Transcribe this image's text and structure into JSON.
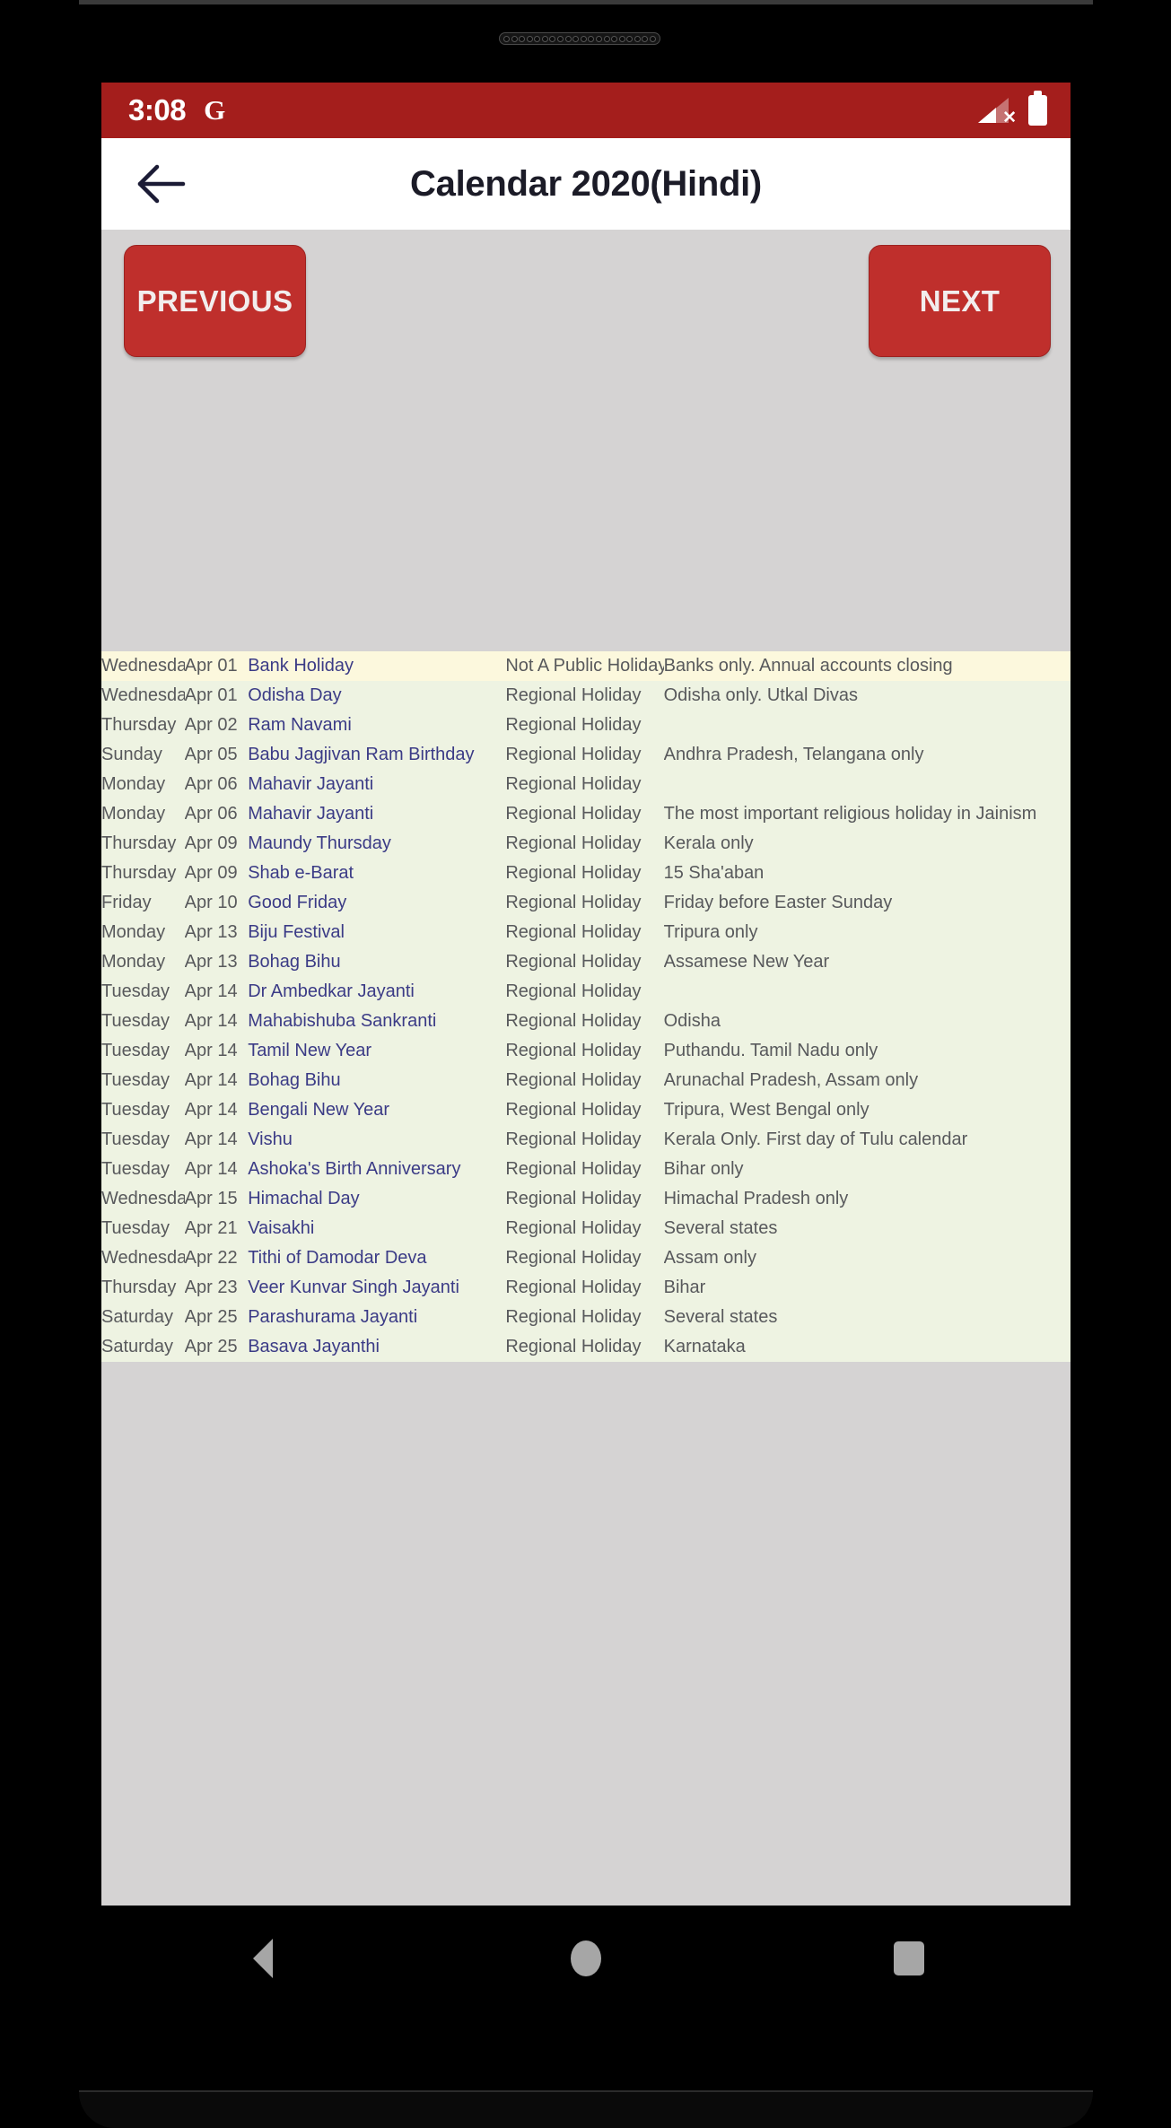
{
  "statusbar": {
    "time": "3:08",
    "google_icon": "G",
    "signal_icon": "signal-no-service-icon",
    "battery_icon": "battery-full-icon"
  },
  "appbar": {
    "back_icon": "back-arrow-icon",
    "title": "Calendar 2020(Hindi)"
  },
  "controls": {
    "previous_label": "PREVIOUS",
    "next_label": "NEXT"
  },
  "colors": {
    "status_bar": "#a41e1c",
    "button": "#bf2f2c",
    "page_background": "#d5d3d3",
    "bank_holiday_row": "#fcf8dd",
    "regional_holiday_row": "#eef3e2",
    "holiday_name_text": "#3b3b86",
    "body_text": "#58595c"
  },
  "holidays": [
    {
      "day": "Wednesday",
      "date": "Apr 01",
      "name": "Bank Holiday",
      "type": "Not A Public Holiday",
      "note": "Banks only. Annual accounts closing",
      "style": "row-bank"
    },
    {
      "day": "Wednesday",
      "date": "Apr 01",
      "name": "Odisha Day",
      "type": "Regional Holiday",
      "note": "Odisha only. Utkal Divas",
      "style": "row-regional"
    },
    {
      "day": "Thursday",
      "date": "Apr 02",
      "name": "Ram Navami",
      "type": "Regional Holiday",
      "note": "",
      "style": "row-regional"
    },
    {
      "day": "Sunday",
      "date": "Apr 05",
      "name": "Babu Jagjivan Ram Birthday",
      "type": "Regional Holiday",
      "note": "Andhra Pradesh, Telangana only",
      "style": "row-regional"
    },
    {
      "day": "Monday",
      "date": "Apr 06",
      "name": "Mahavir Jayanti",
      "type": "Regional Holiday",
      "note": "",
      "style": "row-regional"
    },
    {
      "day": "Monday",
      "date": "Apr 06",
      "name": "Mahavir Jayanti",
      "type": "Regional Holiday",
      "note": "The most important religious holiday in Jainism",
      "style": "row-regional"
    },
    {
      "day": "Thursday",
      "date": "Apr 09",
      "name": "Maundy Thursday",
      "type": "Regional Holiday",
      "note": "Kerala only",
      "style": "row-regional"
    },
    {
      "day": "Thursday",
      "date": "Apr 09",
      "name": "Shab e-Barat",
      "type": "Regional Holiday",
      "note": "15 Sha'aban",
      "style": "row-regional"
    },
    {
      "day": "Friday",
      "date": "Apr 10",
      "name": "Good Friday",
      "type": "Regional Holiday",
      "note": "Friday before Easter Sunday",
      "style": "row-regional"
    },
    {
      "day": "Monday",
      "date": "Apr 13",
      "name": "Biju Festival",
      "type": "Regional Holiday",
      "note": "Tripura only",
      "style": "row-regional"
    },
    {
      "day": "Monday",
      "date": "Apr 13",
      "name": "Bohag Bihu",
      "type": "Regional Holiday",
      "note": "Assamese New Year",
      "style": "row-regional"
    },
    {
      "day": "Tuesday",
      "date": "Apr 14",
      "name": "Dr Ambedkar Jayanti",
      "type": "Regional Holiday",
      "note": "",
      "style": "row-regional"
    },
    {
      "day": "Tuesday",
      "date": "Apr 14",
      "name": "Mahabishuba Sankranti",
      "type": "Regional Holiday",
      "note": "Odisha",
      "style": "row-regional"
    },
    {
      "day": "Tuesday",
      "date": "Apr 14",
      "name": "Tamil New Year",
      "type": "Regional Holiday",
      "note": "Puthandu. Tamil Nadu only",
      "style": "row-regional"
    },
    {
      "day": "Tuesday",
      "date": "Apr 14",
      "name": "Bohag Bihu",
      "type": "Regional Holiday",
      "note": "Arunachal Pradesh, Assam only",
      "style": "row-regional"
    },
    {
      "day": "Tuesday",
      "date": "Apr 14",
      "name": "Bengali New Year",
      "type": "Regional Holiday",
      "note": "Tripura, West Bengal only",
      "style": "row-regional"
    },
    {
      "day": "Tuesday",
      "date": "Apr 14",
      "name": "Vishu",
      "type": "Regional Holiday",
      "note": "Kerala Only. First day of Tulu calendar",
      "style": "row-regional"
    },
    {
      "day": "Tuesday",
      "date": "Apr 14",
      "name": "Ashoka's Birth Anniversary",
      "type": "Regional Holiday",
      "note": "Bihar only",
      "style": "row-regional"
    },
    {
      "day": "Wednesday",
      "date": "Apr 15",
      "name": "Himachal Day",
      "type": "Regional Holiday",
      "note": "Himachal Pradesh only",
      "style": "row-regional"
    },
    {
      "day": "Tuesday",
      "date": "Apr 21",
      "name": "Vaisakhi",
      "type": "Regional Holiday",
      "note": "Several states",
      "style": "row-regional"
    },
    {
      "day": "Wednesday",
      "date": "Apr 22",
      "name": "Tithi of Damodar Deva",
      "type": "Regional Holiday",
      "note": "Assam only",
      "style": "row-regional"
    },
    {
      "day": "Thursday",
      "date": "Apr 23",
      "name": "Veer Kunvar Singh Jayanti",
      "type": "Regional Holiday",
      "note": "Bihar",
      "style": "row-regional"
    },
    {
      "day": "Saturday",
      "date": "Apr 25",
      "name": "Parashurama Jayanti",
      "type": "Regional Holiday",
      "note": "Several states",
      "style": "row-regional"
    },
    {
      "day": "Saturday",
      "date": "Apr 25",
      "name": "Basava Jayanthi",
      "type": "Regional Holiday",
      "note": "Karnataka",
      "style": "row-regional"
    }
  ],
  "navbar": {
    "back_icon": "nav-back-icon",
    "home_icon": "nav-home-icon",
    "recents_icon": "nav-recents-icon"
  }
}
